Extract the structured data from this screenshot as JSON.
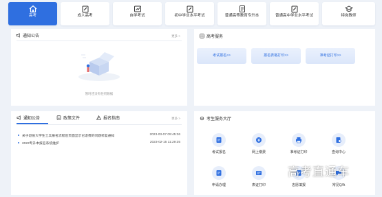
{
  "nav": {
    "items": [
      {
        "label": "高考",
        "icon": "home-icon"
      },
      {
        "label": "成人高考",
        "icon": "pen-icon"
      },
      {
        "label": "自学考试",
        "icon": "chart-card-icon"
      },
      {
        "label": "初中学业水平考试",
        "icon": "pen-icon"
      },
      {
        "label": "普通高等教育专升本",
        "icon": "document-icon"
      },
      {
        "label": "普通高中学业水平考试",
        "icon": "pen-icon"
      },
      {
        "label": "特岗教师",
        "icon": "teacher-icon"
      }
    ],
    "active_color": "#2f6fe0"
  },
  "announcements_panel": {
    "title": "通知公告",
    "more": "更多 >",
    "empty_tip": "暂时还没有任何数据"
  },
  "exam_services": {
    "title": "高考服务",
    "buttons": [
      "考试报名>>",
      "报名表格打印>>",
      "准考证打印>>"
    ]
  },
  "news_panel": {
    "tabs": [
      "通知公告",
      "政策文件",
      "报名指南"
    ],
    "more": "更多 >",
    "rows": [
      {
        "text": "关于退役大学生士兵报名流程后页面显示已退费的问题修复通知",
        "date": "2023-03-07 09:45:36"
      },
      {
        "text": "2023专升本报名系统维护",
        "date": "2023-02-15 11:29:35"
      }
    ]
  },
  "service_hall": {
    "title": "考生服务大厅",
    "items": [
      {
        "label": "考试报名",
        "icon": "exam-sign-icon"
      },
      {
        "label": "网上缴费",
        "icon": "payment-icon"
      },
      {
        "label": "准考证打印",
        "icon": "printer-icon"
      },
      {
        "label": "查询中心",
        "icon": "search-doc-icon"
      },
      {
        "label": "申请办理",
        "icon": "apply-icon"
      },
      {
        "label": "表证打印",
        "icon": "form-print-icon"
      },
      {
        "label": "志愿填报",
        "icon": "volunteer-icon"
      },
      {
        "label": "常见Q/A",
        "icon": "qa-icon"
      }
    ]
  },
  "watermark": "高考直通车"
}
